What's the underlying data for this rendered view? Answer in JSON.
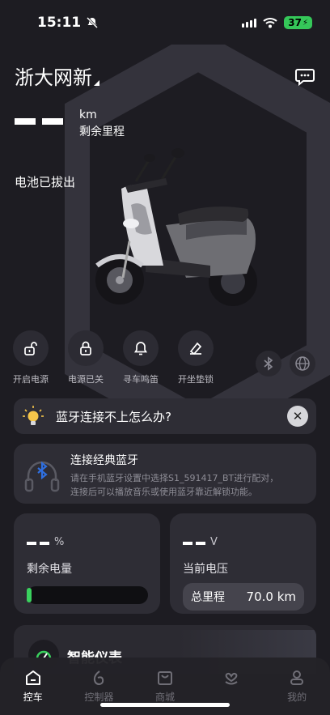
{
  "status_bar": {
    "time": "15:11",
    "battery_level": "37"
  },
  "header": {
    "vehicle_name": "浙大网新"
  },
  "range": {
    "unit": "km",
    "label": "剩余里程"
  },
  "battery_status": "电池已拔出",
  "actions": [
    {
      "label": "开启电源",
      "icon": "unlock-icon"
    },
    {
      "label": "电源已关",
      "icon": "lock-icon"
    },
    {
      "label": "寻车鸣笛",
      "icon": "bell-icon"
    },
    {
      "label": "开坐垫锁",
      "icon": "seat-lock-icon"
    }
  ],
  "help_banner": {
    "text": "蓝牙连接不上怎么办?"
  },
  "bluetooth_card": {
    "title": "连接经典蓝牙",
    "description_line1": "请在手机蓝牙设置中选择S1_591417_BT进行配对，",
    "description_line2": "连接后可以播放音乐或使用蓝牙靠近解锁功能。"
  },
  "power_card": {
    "unit": "%",
    "label": "剩余电量",
    "level": 0
  },
  "voltage_card": {
    "unit": "V",
    "label": "当前电压",
    "odometer_label": "总里程",
    "odometer_value": "70.0 km"
  },
  "dashboard_card": {
    "title": "智能仪表"
  },
  "tabs": [
    {
      "label": "控车",
      "icon": "home-icon",
      "active": true
    },
    {
      "label": "控制器",
      "icon": "controller-icon",
      "active": false
    },
    {
      "label": "商城",
      "icon": "shop-icon",
      "active": false
    },
    {
      "label": "",
      "icon": "heart-hand-icon",
      "active": false
    },
    {
      "label": "我的",
      "icon": "profile-icon",
      "active": false
    }
  ],
  "colors": {
    "background": "#1d1c22",
    "card": "#2e2d35",
    "accent_green": "#3ad15e",
    "bluetooth_blue": "#2f6fe0"
  }
}
